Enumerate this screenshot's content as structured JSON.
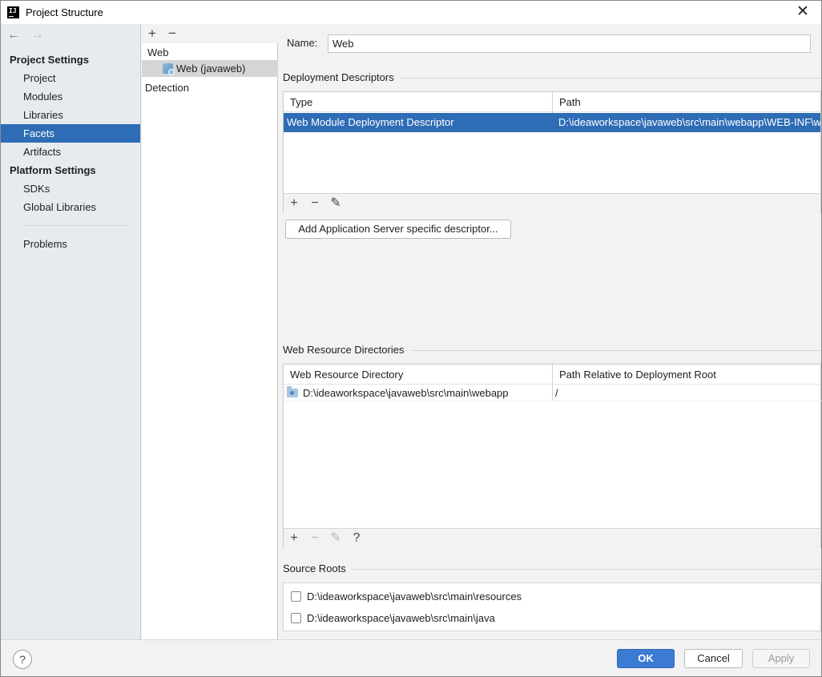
{
  "window": {
    "app_icon": "intellij-idea-icon",
    "title": "Project Structure",
    "close_label": "✕"
  },
  "sidebar": {
    "back_arrow": "←",
    "forward_arrow": "→",
    "project_settings_title": "Project Settings",
    "project_items": [
      {
        "label": "Project",
        "selected": false
      },
      {
        "label": "Modules",
        "selected": false
      },
      {
        "label": "Libraries",
        "selected": false
      },
      {
        "label": "Facets",
        "selected": true
      },
      {
        "label": "Artifacts",
        "selected": false
      }
    ],
    "platform_settings_title": "Platform Settings",
    "platform_items": [
      {
        "label": "SDKs"
      },
      {
        "label": "Global Libraries"
      }
    ],
    "problems_label": "Problems"
  },
  "tree": {
    "add_label": "+",
    "remove_label": "−",
    "group_label": "Web",
    "child_label": "Web (javaweb)",
    "detection_label": "Detection"
  },
  "content": {
    "name_label": "Name:",
    "name_value": "Web",
    "deployment": {
      "title": "Deployment Descriptors",
      "col_type": "Type",
      "col_path": "Path",
      "rows": [
        {
          "type": "Web Module Deployment Descriptor",
          "path": "D:\\ideaworkspace\\javaweb\\src\\main\\webapp\\WEB-INF\\web.xml",
          "selected": true
        }
      ],
      "toolbar": {
        "add": "+",
        "remove": "−",
        "edit": "✎"
      },
      "add_server_button": "Add Application Server specific descriptor..."
    },
    "resources": {
      "title": "Web Resource Directories",
      "col_dir": "Web Resource Directory",
      "col_rel": "Path Relative to Deployment Root",
      "rows": [
        {
          "dir": "D:\\ideaworkspace\\javaweb\\src\\main\\webapp",
          "rel": "/"
        }
      ],
      "toolbar": {
        "add": "+",
        "remove": "−",
        "edit": "✎",
        "help": "?"
      }
    },
    "source_roots": {
      "title": "Source Roots",
      "items": [
        {
          "path": "D:\\ideaworkspace\\javaweb\\src\\main\\resources",
          "checked": false
        },
        {
          "path": "D:\\ideaworkspace\\javaweb\\src\\main\\java",
          "checked": false
        }
      ]
    }
  },
  "footer": {
    "help_label": "?",
    "ok_label": "OK",
    "cancel_label": "Cancel",
    "apply_label": "Apply"
  },
  "colors": {
    "selection": "#2e6cb5",
    "ok_button": "#3b7bd1",
    "sidebar_bg": "#e7ebf0"
  }
}
